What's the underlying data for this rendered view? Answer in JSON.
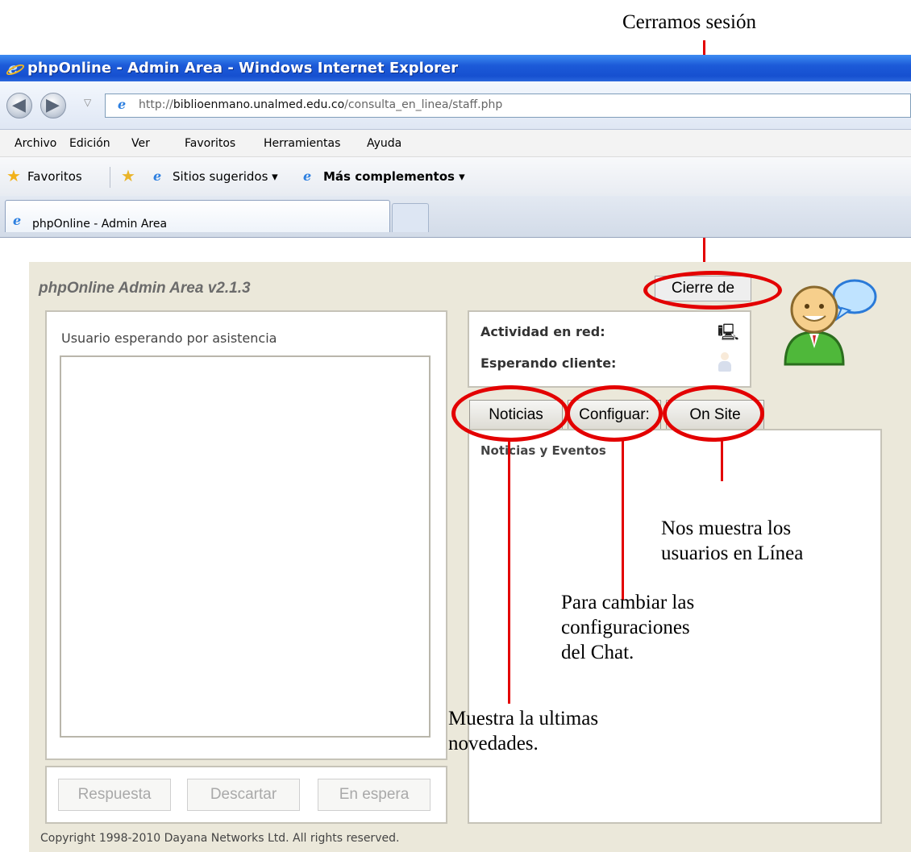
{
  "annotations": {
    "logout": "Cerramos sesión",
    "on_site": [
      "Nos muestra los",
      "usuarios en Línea"
    ],
    "config": [
      "Para cambiar las",
      "configuraciones",
      "del Chat."
    ],
    "news": [
      "Muestra la ultimas",
      "novedades."
    ]
  },
  "browser": {
    "window_title": "phpOnline - Admin Area - Windows Internet Explorer",
    "url_prefix": "http://",
    "url_host": "biblioenmano.unalmed.edu.co",
    "url_path": "/consulta_en_linea/staff.php",
    "menu": [
      "Archivo",
      "Edición",
      "Ver",
      "Favoritos",
      "Herramientas",
      "Ayuda"
    ],
    "favorites": {
      "favorites_label": "Favoritos",
      "suggested_sites": "Sitios sugeridos ▾",
      "more_addons": "Más complementos ▾"
    },
    "tab_title": "phpOnline - Admin Area"
  },
  "app": {
    "title": "phpOnline Admin Area v2.1.3",
    "logout_button": "Cierre de",
    "waiting_header": "Usuario esperando por asistencia",
    "actions": {
      "respond": "Respuesta",
      "discard": "Descartar",
      "on_hold": "En espera"
    },
    "status": {
      "network_activity": "Actividad en red:",
      "waiting_client": "Esperando cliente:"
    },
    "tabs": [
      "Noticias",
      "Configuar:",
      "On Site"
    ],
    "news_heading": "Noticias y Eventos",
    "footer": "Copyright 1998-2010 Dayana Networks Ltd. All rights reserved."
  },
  "colors": {
    "annotation_red": "#e30000",
    "app_background": "#ebe8da",
    "titlebar_blue": "#1c5ad8"
  }
}
